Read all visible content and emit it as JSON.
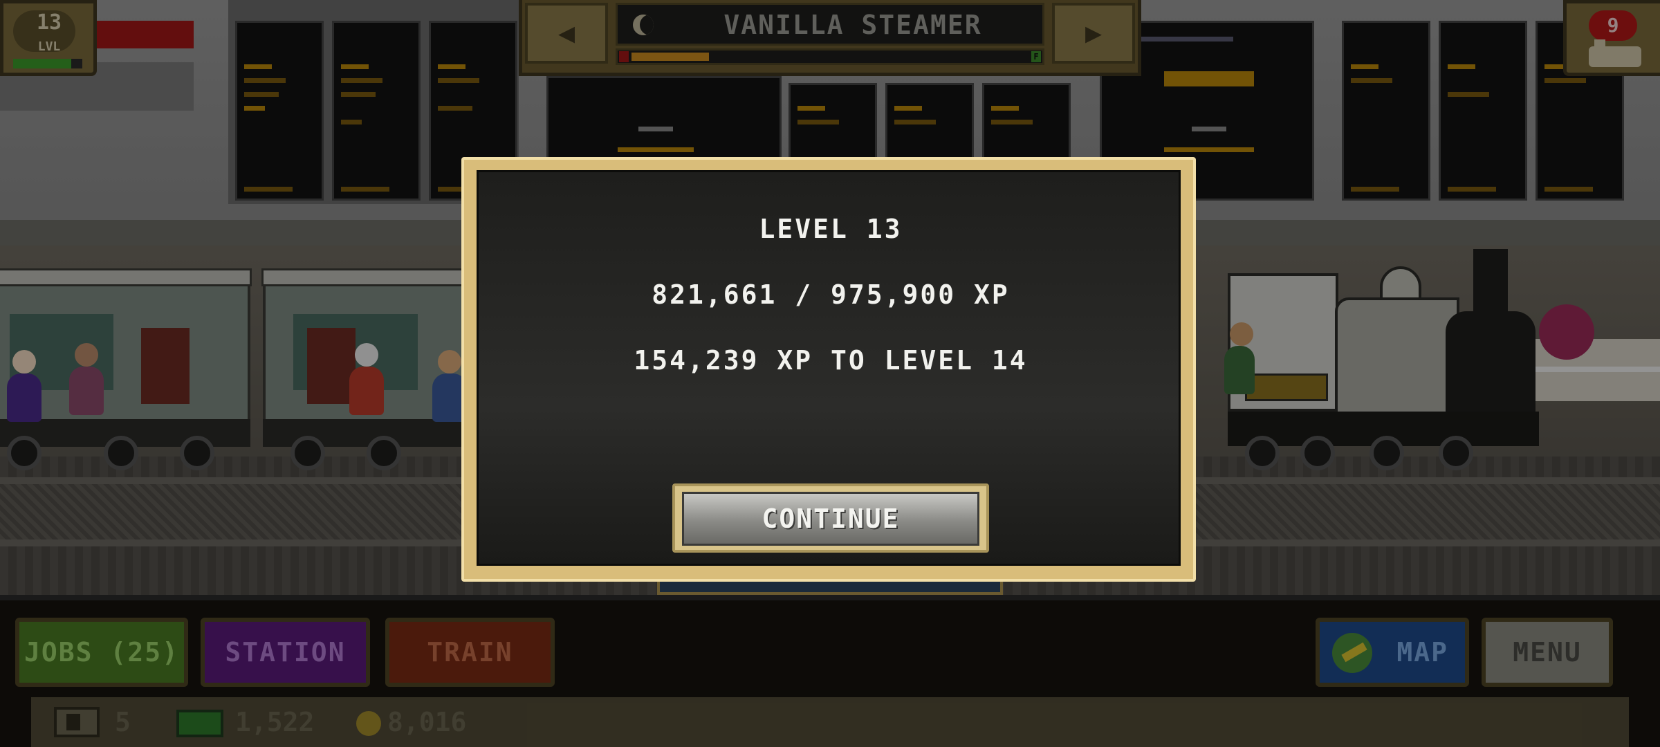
{
  "hud": {
    "level_number": "13",
    "level_label": "LVL",
    "xp_progress": 0.84,
    "train_name": "VANILLA STEAMER",
    "prev_arrow": "◀",
    "next_arrow": "▶",
    "fuel_full_label": "F",
    "fuel_level": 0.2,
    "notification_count": "9"
  },
  "bottom": {
    "jobs_label": "JOBS (25)",
    "station_label": "STATION",
    "train_label": "TRAIN",
    "map_label": "MAP",
    "menu_label": "MENU",
    "tickets": "5",
    "cash": "1,522",
    "coins": "8,016"
  },
  "dialog": {
    "title": "LEVEL 13",
    "xp_progress": "821,661 / 975,900 XP",
    "xp_to_next": "154,239 XP TO LEVEL 14",
    "continue_label": "CONTINUE"
  },
  "colors": {
    "dialog_frame": "#d9bd7a",
    "jobs_button": "#4a7a22",
    "station_button": "#5a1a7a",
    "train_button": "#7a2a14",
    "map_button": "#1e4a8a",
    "menu_button": "#8a8a80"
  }
}
